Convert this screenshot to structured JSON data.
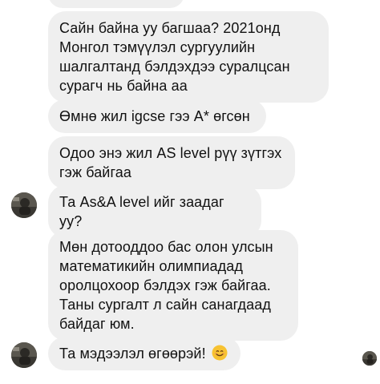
{
  "conversation": {
    "messages": [
      {
        "text": "Сайн байна уу багшаа? 2021онд Монгол тэмүүлэл сургуулийн шалгалтанд бэлдэхдээ суралцсан сурагч нь байна аа"
      },
      {
        "text": "Өмнө жил igcse гээ A* өгсөн"
      },
      {
        "text": "Одоо энэ жил AS level рүү зүтгэх гэж байгаа"
      },
      {
        "text": "Та As&A level ийг заадаг уу?"
      },
      {
        "text": "Мөн дотооддоо бас олон улсын математикийн олимпиадад оролцохоор бэлдэх гэж байгаа. Таны сургалт л сайн санагдаад байдаг юм."
      },
      {
        "text": "Та мэдээлэл өгөөрэй!",
        "emoji": "smiling-face-emoji"
      }
    ]
  },
  "colors": {
    "bubble_bg": "#efefef",
    "text": "#111111",
    "background": "#ffffff"
  }
}
